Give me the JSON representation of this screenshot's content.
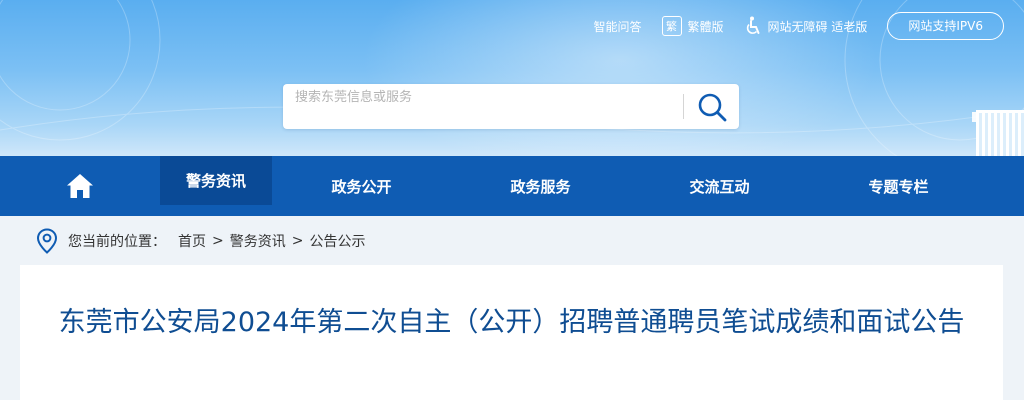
{
  "toolbar": {
    "smart_qa": "智能问答",
    "traditional_icon_char": "繁",
    "traditional": "繁體版",
    "accessibility": "网站无障碍 适老版",
    "ipv6": "网站支持IPV6"
  },
  "search": {
    "placeholder": "搜索东莞信息或服务"
  },
  "nav": {
    "items": [
      "警务资讯",
      "政务公开",
      "政务服务",
      "交流互动",
      "专题专栏"
    ]
  },
  "breadcrumb": {
    "prefix": "您当前的位置：",
    "items": [
      "首页",
      "警务资讯",
      "公告公示"
    ],
    "separator": ">"
  },
  "article": {
    "title": "东莞市公安局2024年第二次自主（公开）招聘普通聘员笔试成绩和面试公告"
  },
  "colors": {
    "nav_bg": "#0f5cb3",
    "nav_active": "#0a4a96",
    "title": "#0f4d92",
    "banner_top": "#5aaef0"
  },
  "icons": {
    "home": "home-icon",
    "search": "search-icon",
    "location": "location-pin-icon",
    "accessibility": "wheelchair-icon"
  }
}
